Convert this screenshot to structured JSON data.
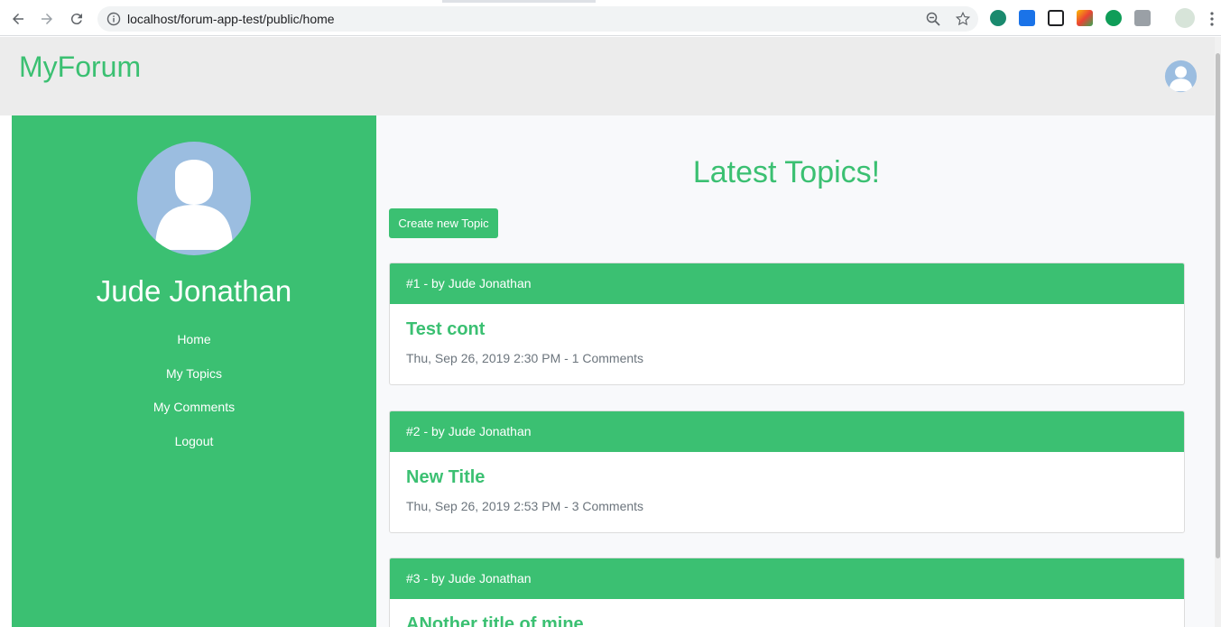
{
  "browser": {
    "url": "localhost/forum-app-test/public/home"
  },
  "app": {
    "brand": "MyForum",
    "accent_color": "#3bc072",
    "avatar_icon": "user-avatar-icon"
  },
  "sidebar": {
    "user_name": "Jude Jonathan",
    "items": [
      {
        "label": "Home"
      },
      {
        "label": "My Topics"
      },
      {
        "label": "My Comments"
      },
      {
        "label": "Logout"
      }
    ]
  },
  "main": {
    "title": "Latest Topics!",
    "create_button_label": "Create new Topic",
    "topics": [
      {
        "header": "#1 - by Jude Jonathan",
        "title": "Test cont",
        "date": "Thu, Sep 26, 2019 2:30 PM",
        "separator": "-",
        "comments": "1 Comments"
      },
      {
        "header": "#2 - by Jude Jonathan",
        "title": "New Title",
        "date": "Thu, Sep 26, 2019 2:53 PM",
        "separator": "-",
        "comments": "3 Comments"
      },
      {
        "header": "#3 - by Jude Jonathan",
        "title": "ANother title of mine",
        "date": "",
        "separator": "",
        "comments": ""
      }
    ]
  }
}
